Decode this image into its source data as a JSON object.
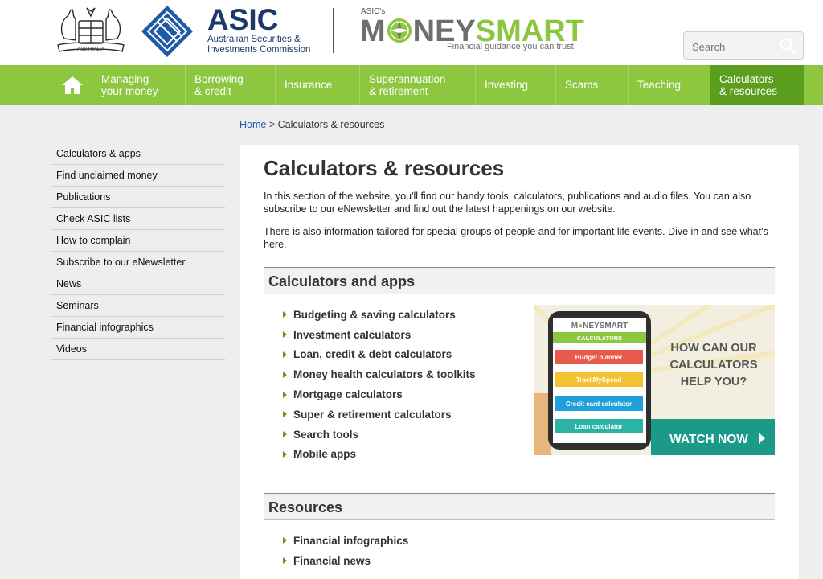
{
  "header": {
    "asic_title": "ASIC",
    "asic_subtitle": "Australian Securities & Investments Commission",
    "moneysmart_small": "ASIC's",
    "moneysmart_left": "M",
    "moneysmart_mid": "NEY",
    "moneysmart_right": "SMART",
    "moneysmart_tagline": "Financial guidance you can trust",
    "crest_text": "AUSTRALIA",
    "search": {
      "placeholder": "Search"
    }
  },
  "nav": {
    "items": [
      {
        "label1": "Managing",
        "label2": "your money"
      },
      {
        "label1": "Borrowing",
        "label2": "& credit"
      },
      {
        "label1": "Insurance",
        "label2": ""
      },
      {
        "label1": "Superannuation",
        "label2": "& retirement"
      },
      {
        "label1": "Investing",
        "label2": ""
      },
      {
        "label1": "Scams",
        "label2": ""
      },
      {
        "label1": "Teaching",
        "label2": ""
      },
      {
        "label1": "Calculators",
        "label2": "& resources"
      }
    ]
  },
  "breadcrumb": {
    "home": "Home",
    "separator": ">",
    "current": "Calculators & resources"
  },
  "sidebar": {
    "items": [
      "Calculators & apps",
      "Find unclaimed money",
      "Publications",
      "Check ASIC lists",
      "How to complain",
      "Subscribe to our eNewsletter",
      "News",
      "Seminars",
      "Financial infographics",
      "Videos"
    ]
  },
  "main": {
    "title": "Calculators & resources",
    "intro": "In this section of the website, you'll find our handy tools, calculators, publications and audio files. You can also subscribe to our eNewsletter and find out the latest happenings on our website.",
    "intro2": "There is also information tailored for special groups of people and for important life events. Dive in and see what's here.",
    "calculators_heading": "Calculators and apps",
    "calculator_links": [
      "Budgeting & saving calculators",
      "Investment calculators",
      "Loan, credit & debt calculators",
      "Money health calculators & toolkits",
      "Mortgage calculators",
      "Super & retirement calculators",
      "Search tools",
      "Mobile apps"
    ],
    "resources_heading": "Resources",
    "resource_links": [
      "Financial infographics",
      "Financial news"
    ]
  },
  "promo": {
    "phone_brand_left": "M",
    "phone_brand_mid": "NEYSMART",
    "phone_header": "CALCULATORS",
    "buttons": [
      "Budget planner",
      "TrackMySpend",
      "Credit card calculator",
      "Loan calculator"
    ],
    "question1": "HOW CAN OUR",
    "question2": "CALCULATORS",
    "question3": "HELP YOU?",
    "cta": "WATCH NOW"
  },
  "colors": {
    "nav_green": "#8dc63f",
    "nav_active": "#5b9e1e",
    "asic_navy": "#1b3a6b",
    "asic_blue": "#1e5aa8",
    "link_blue": "#1a5fa8",
    "promo_teal": "#1b9a8a"
  },
  "icons": {
    "home": "home-icon",
    "search": "search-icon",
    "crest": "coat-of-arms-icon",
    "asic": "asic-diamond-icon",
    "compass": "compass-icon",
    "arrow": "arrow-right-icon"
  }
}
